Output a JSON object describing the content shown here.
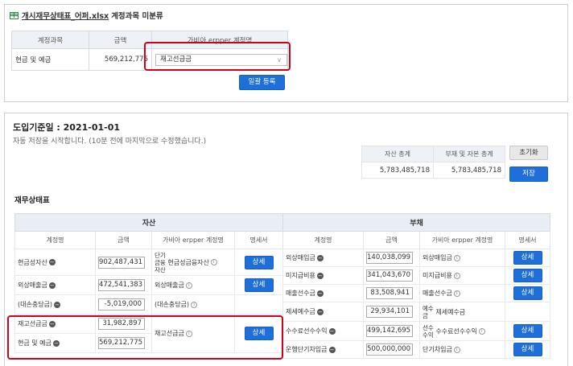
{
  "panel1": {
    "file_name": "개시재무상태표_어퍼.xlsx",
    "title_suffix": "계정과목 미분류",
    "headers": [
      "계정과목",
      "금액",
      "가비아 erpper 계정명"
    ],
    "row": {
      "account": "현금 및 예금",
      "amount": "569,212,775",
      "select_value": "재고선급금"
    },
    "bulk_button": "일괄 등록"
  },
  "panel2": {
    "title": "도입기준일 : 2021-01-01",
    "autosave": "자동 저장을 시작합니다. (10분 전에 마지막으로 수정했습니다.)",
    "totals": {
      "assets_label": "자산 총계",
      "liab_label": "부채 및 자본 총계",
      "assets_value": "5,783,485,718",
      "liab_value": "5,783,485,718"
    },
    "reset_button": "초기화",
    "save_button": "저장",
    "section_title": "재무상태표"
  },
  "assets": {
    "group": "자산",
    "headers": [
      "계정명",
      "금액",
      "가비아 erpper 계정명",
      "명세서"
    ],
    "rows": [
      {
        "name": "현금성자산",
        "amount": "902,487,431",
        "erp": "현금성금융자산",
        "erp_prefix": [
          "단기",
          "금융",
          "자산"
        ],
        "detail": "상세"
      },
      {
        "name": "외상매출금",
        "amount": "472,541,383",
        "erp": "외상매출금",
        "detail": "상세"
      },
      {
        "name": "(대손충당금)",
        "amount": "-5,019,000",
        "erp": "(대손충당금)"
      },
      {
        "name": "재고선급금",
        "amount": "31,982,897",
        "erp": "재고선급금",
        "detail": "상세"
      },
      {
        "name": "현금 및 예금",
        "amount": "569,212,775"
      }
    ]
  },
  "liabilities": {
    "group": "부채",
    "headers": [
      "계정명",
      "금액",
      "가비아 erpper 계정명",
      "명세서"
    ],
    "rows": [
      {
        "name": "외상매입금",
        "amount": "140,038,099",
        "erp": "외상매입금",
        "detail": "상세"
      },
      {
        "name": "미지급비용",
        "amount": "341,043,670",
        "erp": "미지급비용",
        "detail": "상세"
      },
      {
        "name": "매출선수금",
        "amount": "83,508,941",
        "erp": "매출선수금",
        "detail": "상세"
      },
      {
        "name": "제세예수금",
        "amount": "29,934,101",
        "erp": "제세예수금",
        "erp_prefix": [
          "예수",
          "금"
        ]
      },
      {
        "name": "수수료선수수익",
        "amount": "499,142,695",
        "erp": "수수료선수수익",
        "erp_prefix": [
          "선수",
          "수익"
        ],
        "detail": "상세"
      },
      {
        "name": "운행단기차입금",
        "amount": "500,000,000",
        "erp": "단기차입금",
        "detail": "상세"
      }
    ]
  }
}
